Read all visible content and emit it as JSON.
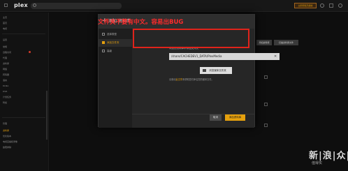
{
  "app": {
    "logo_text": "plex",
    "premium_label": "立即获取高级版"
  },
  "sidebar": {
    "items": [
      {
        "label": "主页",
        "active": false
      },
      {
        "label": "首页",
        "active": false
      },
      {
        "label": "电视",
        "active": false
      },
      {
        "label": "设置",
        "active": false
      },
      {
        "label": "常规",
        "active": false
      },
      {
        "label": "远程访问",
        "active": false
      },
      {
        "label": "代理",
        "active": false
      },
      {
        "label": "资料库",
        "active": false
      },
      {
        "label": "网络",
        "active": false
      },
      {
        "label": "转码器",
        "active": false
      },
      {
        "label": "语言",
        "active": false
      },
      {
        "label": "DLNA",
        "active": false
      },
      {
        "label": "DVR",
        "active": false
      },
      {
        "label": "计划任务",
        "active": false
      },
      {
        "label": "附加",
        "active": false
      },
      {
        "label": "管理",
        "active": false
      },
      {
        "label": "资料库",
        "active": true
      },
      {
        "label": "优化版本",
        "active": false
      },
      {
        "label": "电视直播和录像",
        "active": false
      },
      {
        "label": "故障排除",
        "active": false
      }
    ]
  },
  "background": {
    "buttons": [
      "添加资料库",
      "扫描资料库文件"
    ]
  },
  "modal": {
    "title": "添加 资料库",
    "nav": [
      {
        "label": "选择类型",
        "icon": "list-icon",
        "active": false
      },
      {
        "label": "添加文件夹",
        "icon": "folder-icon",
        "active": true
      },
      {
        "label": "高级",
        "icon": "gear-icon",
        "active": false
      }
    ],
    "field_label": "向您的资料库中添加文件夹",
    "path_value": "/share/CACHEDEV1_DATA/PlexMedia",
    "browse_label": "浏览媒体文件夹",
    "hint_prefix": "请参阅",
    "hint_link": "此文章",
    "hint_suffix": "来帮助您们命名您的媒体文件。",
    "cancel_label": "取消",
    "add_label": "添加资料库"
  },
  "annotation": {
    "text": "文件夹不要有中文。容易出BUG",
    "color": "#e0231b"
  },
  "watermark": {
    "text": "新|浪|众|测",
    "subtext": "值得买"
  },
  "colors": {
    "accent": "#e5a00d",
    "annotation_red": "#e0231b",
    "background": "#0d0d0d"
  }
}
